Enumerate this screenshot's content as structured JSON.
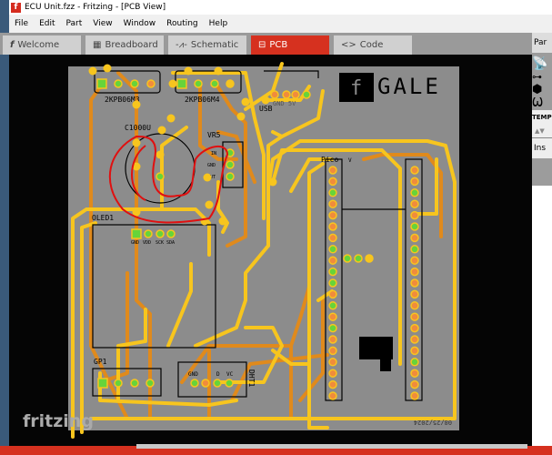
{
  "window": {
    "title": "ECU Unit.fzz - Fritzing - [PCB View]",
    "app_icon": "f"
  },
  "menu": [
    "File",
    "Edit",
    "Part",
    "View",
    "Window",
    "Routing",
    "Help"
  ],
  "tabs": [
    {
      "label": "Welcome",
      "icon": "fritzing-f-icon"
    },
    {
      "label": "Breadboard",
      "icon": "breadboard-icon"
    },
    {
      "label": "Schematic",
      "icon": "resistor-icon"
    },
    {
      "label": "PCB",
      "icon": "pcb-icon",
      "active": true
    },
    {
      "label": "Code",
      "icon": "code-brackets-icon"
    }
  ],
  "right_panel": {
    "parts_label": "Par",
    "temp_label": "TEMP",
    "inspector_label": "Ins"
  },
  "pcb": {
    "labels": {
      "conn1": "2KPB06M3",
      "conn2": "2KPB06M4",
      "usb": "USB",
      "usb_pins": "GND 5V",
      "cap": "C1000U",
      "vr": "VR5",
      "vr_in": "IN",
      "vr_gnd": "GND",
      "vr_out": "OUT",
      "oled": "OLED1",
      "oled_pins": [
        "GND",
        "VDD",
        "SCK",
        "SDA"
      ],
      "pico": "Pico",
      "pico_v": "V",
      "gp": "GP1",
      "dht": "DHT1",
      "dht_pins": [
        "GND",
        "D",
        "VC"
      ],
      "brand": "GALE",
      "brand_icon": "f",
      "date": "08/25/2024",
      "pico_small": "RESET"
    },
    "colors": {
      "board": "#8c8c8c",
      "top_trace": "#f7c51e",
      "bottom_trace": "#e08a1c",
      "pad_green": "#66d43a",
      "pad_orange": "#f08c3c",
      "annotation": "#e01010"
    }
  },
  "watermark": "fritzing"
}
